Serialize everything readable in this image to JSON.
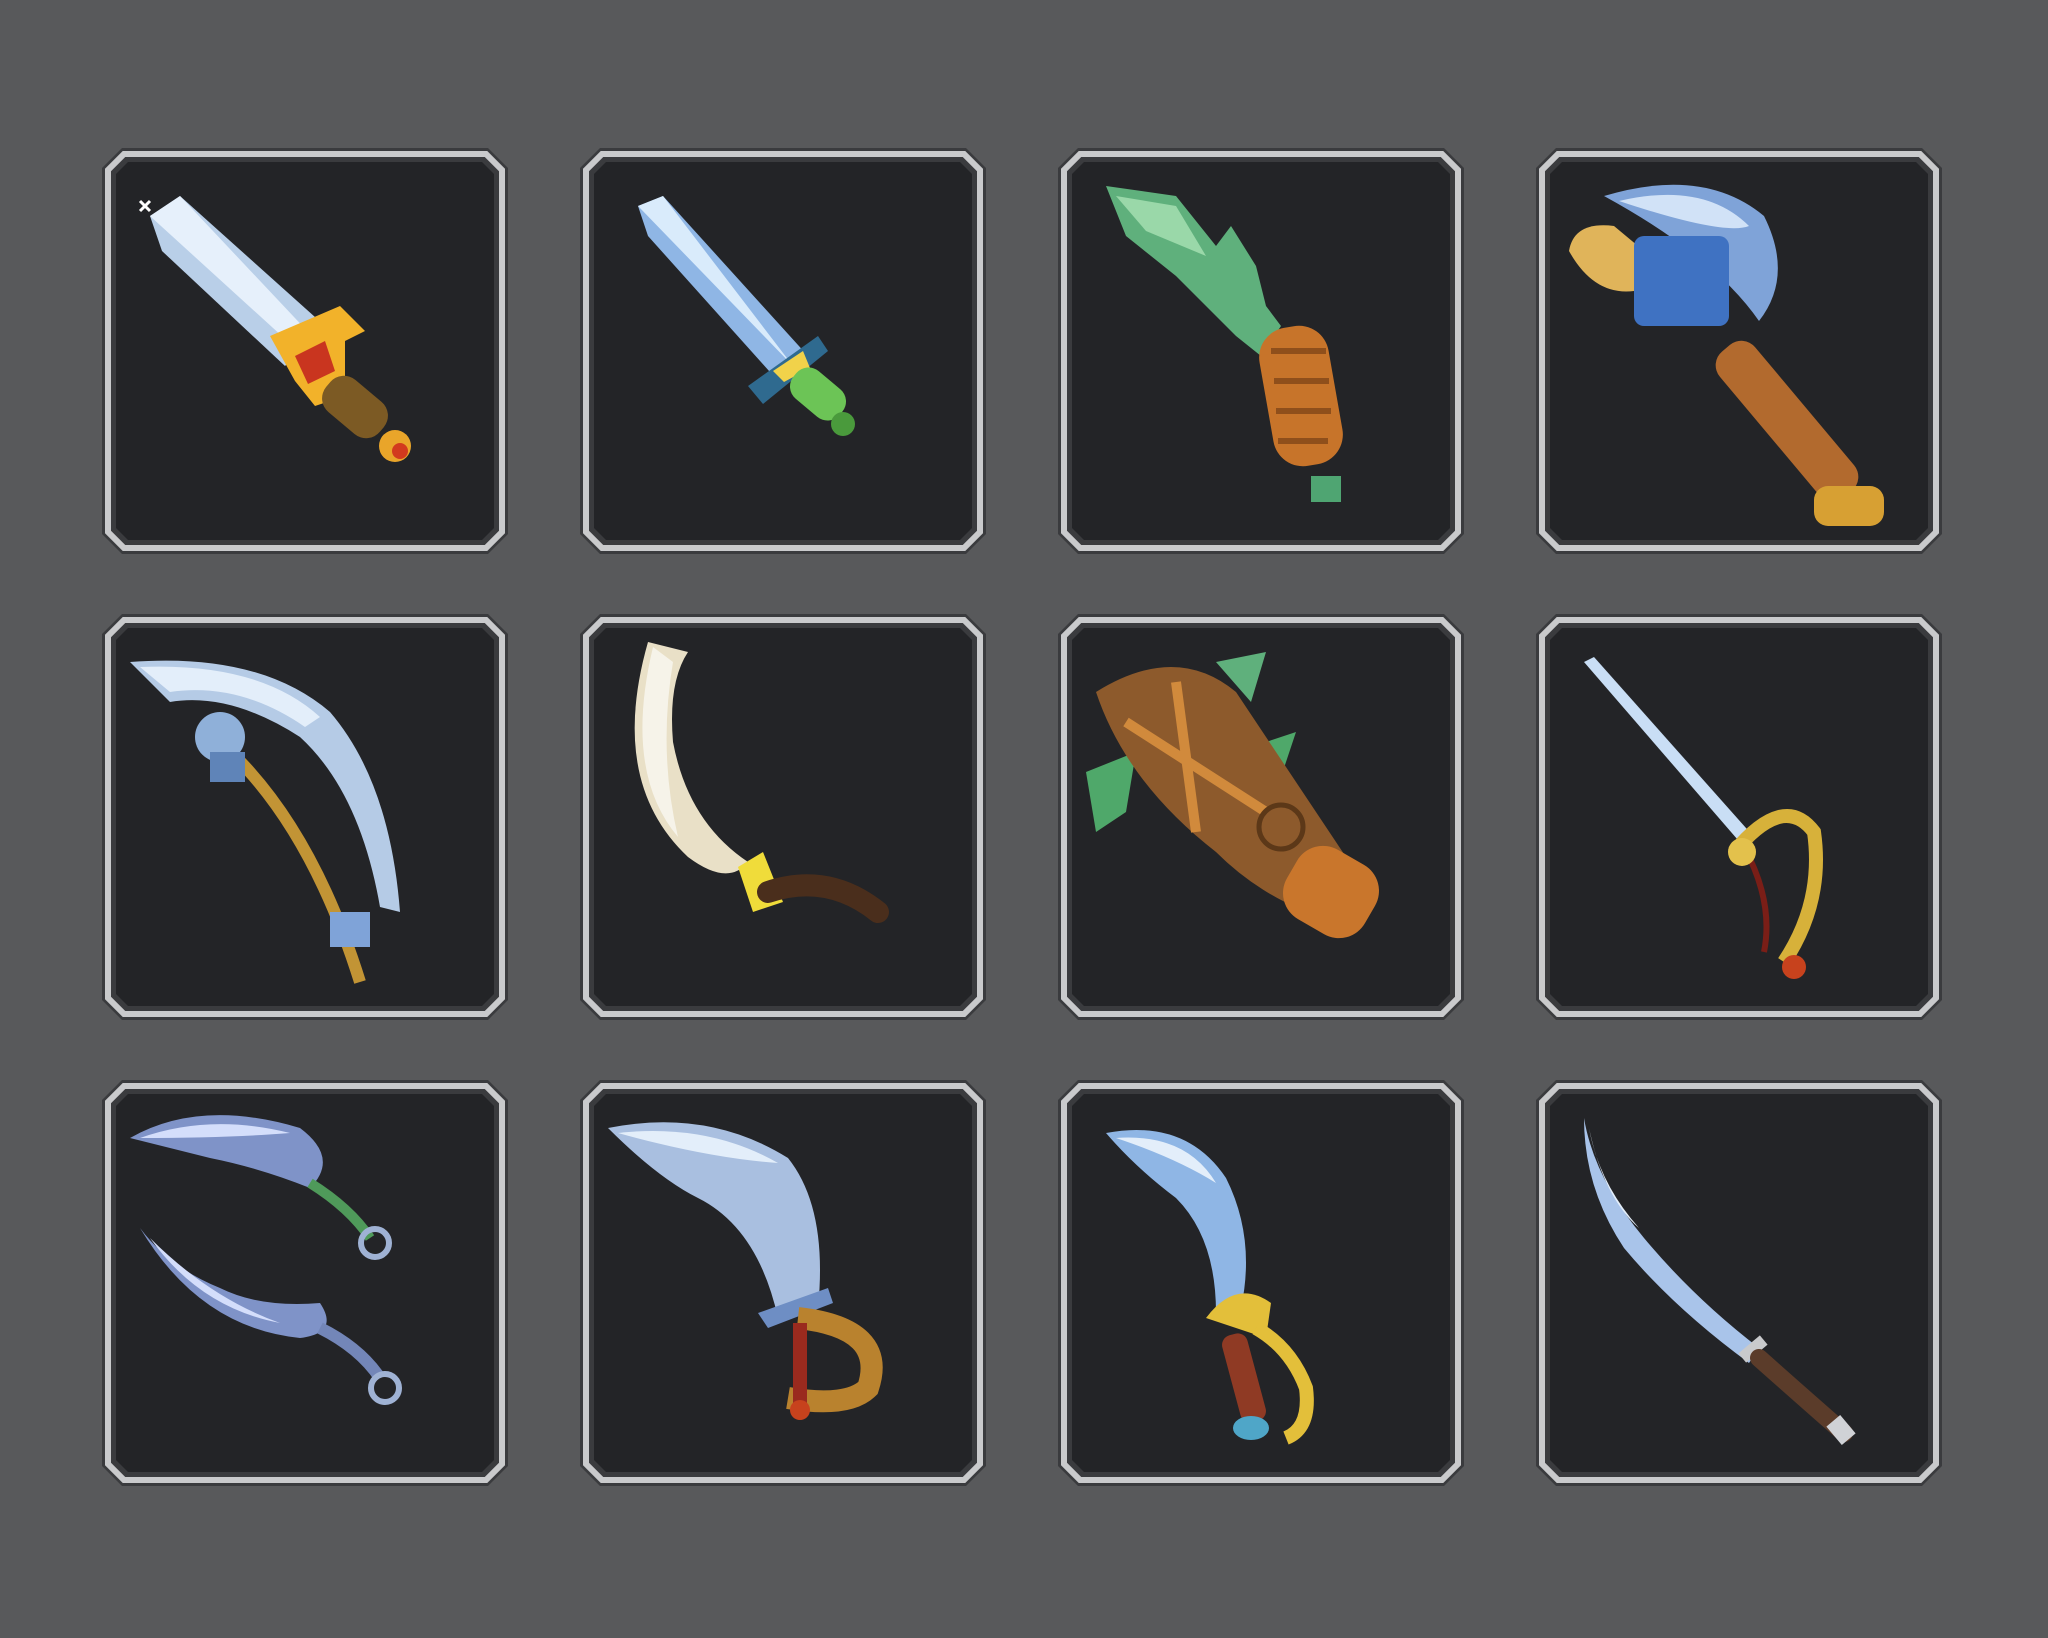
{
  "inventory": {
    "background_color": "#58595b",
    "slot_color": "#232427",
    "rim_color": "#c9cacc",
    "slots": [
      {
        "item_icon": "golden-hilt-sword-icon",
        "accent": "#f2b22a"
      },
      {
        "item_icon": "crystal-short-sword-icon",
        "accent": "#3f9a8e"
      },
      {
        "item_icon": "jade-dagger-icon",
        "accent": "#5fb07c"
      },
      {
        "item_icon": "steel-battle-axe-icon",
        "accent": "#3f72c2"
      },
      {
        "item_icon": "war-scythe-icon",
        "accent": "#b5cbe6"
      },
      {
        "item_icon": "bone-sickle-icon",
        "accent": "#e9e0c7"
      },
      {
        "item_icon": "wooden-leaf-club-icon",
        "accent": "#8d5a2c"
      },
      {
        "item_icon": "rapier-icon",
        "accent": "#d7b13a"
      },
      {
        "item_icon": "twin-daggers-icon",
        "accent": "#7f93c8"
      },
      {
        "item_icon": "broad-cutlass-icon",
        "accent": "#b9822e"
      },
      {
        "item_icon": "curved-saber-icon",
        "accent": "#e3bf3a"
      },
      {
        "item_icon": "katana-icon",
        "accent": "#5b3c2a"
      }
    ]
  }
}
